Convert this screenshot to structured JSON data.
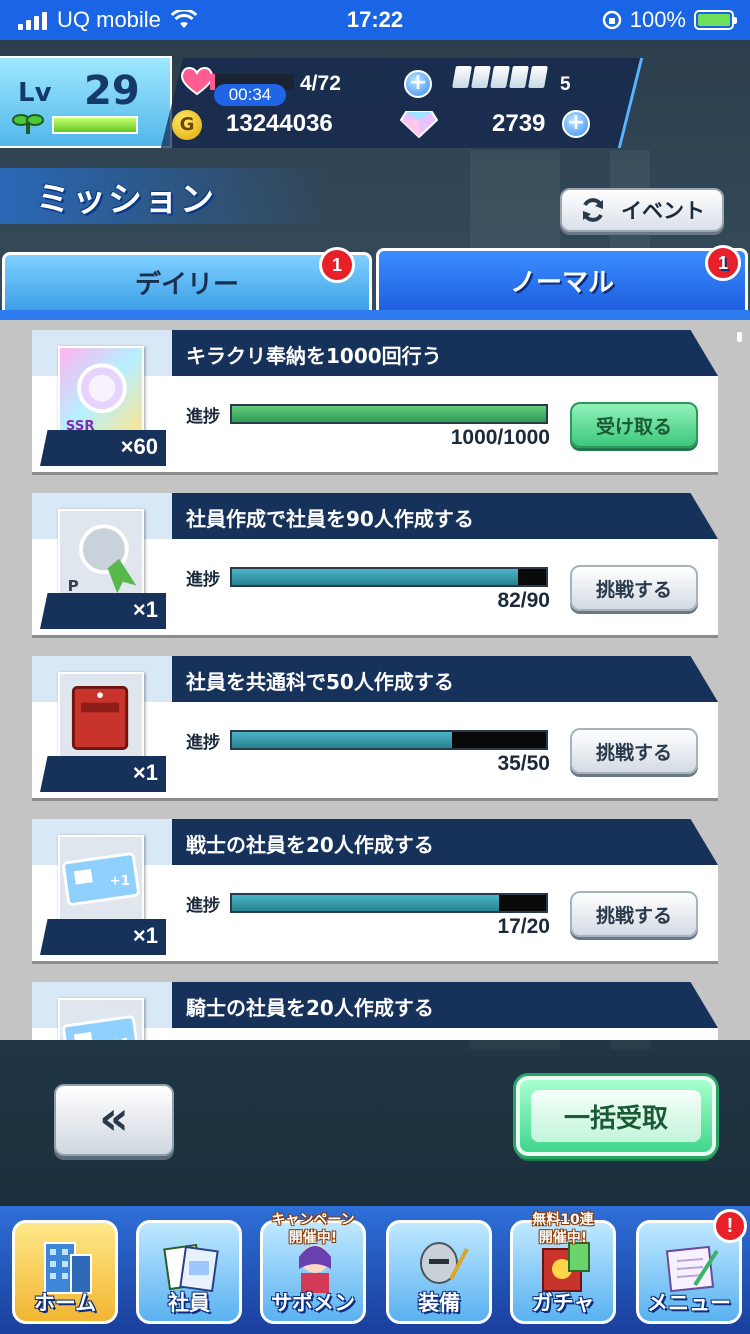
{
  "status_bar": {
    "carrier": "UQ mobile",
    "time": "17:22",
    "battery": "100%"
  },
  "player": {
    "level_label": "Lv",
    "level": "29",
    "exp_fraction": 1.0
  },
  "resources": {
    "stamina_timer": "00:34",
    "stamina": "4/72",
    "stamina_fraction": 0.06,
    "tickets": "5",
    "gold": "13244036",
    "gems": "2739"
  },
  "header": {
    "title": "ミッション",
    "event_button": "イベント"
  },
  "tabs": [
    {
      "label": "デイリー",
      "badge": "1"
    },
    {
      "label": "ノーマル",
      "badge": "1"
    }
  ],
  "progress_label": "進捗",
  "missions": [
    {
      "title": "キラクリ奉納を1000回行う",
      "reward_icon": "ssr-medal-icon",
      "qty": "×60",
      "progress": "1000/1000",
      "fraction": 1.0,
      "button": "受け取る",
      "state": "claim"
    },
    {
      "title": "社員作成で社員を90人作成する",
      "reward_icon": "silver-medal-icon",
      "qty": "×1",
      "progress": "82/90",
      "fraction": 0.911,
      "button": "挑戦する",
      "state": "challenge"
    },
    {
      "title": "社員を共通科で50人作成する",
      "reward_icon": "red-book-icon",
      "qty": "×1",
      "progress": "35/50",
      "fraction": 0.7,
      "button": "挑戦する",
      "state": "challenge"
    },
    {
      "title": "戦士の社員を20人作成する",
      "reward_icon": "ticket-icon",
      "qty": "×1",
      "progress": "17/20",
      "fraction": 0.85,
      "button": "挑戦する",
      "state": "challenge"
    },
    {
      "title": "騎士の社員を20人作成する",
      "reward_icon": "ticket-icon",
      "qty": "",
      "progress": "",
      "fraction": 0,
      "button": "",
      "state": "partial"
    }
  ],
  "actions": {
    "back": "«",
    "claim_all": "一括受取"
  },
  "nav": [
    {
      "label": "ホーム",
      "tag": "",
      "icon": "building-icon",
      "active": true,
      "badge": ""
    },
    {
      "label": "社員",
      "tag": "",
      "icon": "employee-cards-icon",
      "active": false,
      "badge": ""
    },
    {
      "label": "サポメン",
      "tag": "キャンペーン\n開催中!",
      "icon": "support-member-icon",
      "active": false,
      "badge": ""
    },
    {
      "label": "装備",
      "tag": "",
      "icon": "armor-icon",
      "active": false,
      "badge": ""
    },
    {
      "label": "ガチャ",
      "tag": "無料10連\n開催中!",
      "icon": "gacha-icon",
      "active": false,
      "badge": ""
    },
    {
      "label": "メニュー",
      "tag": "",
      "icon": "notebook-icon",
      "active": false,
      "badge": "!"
    }
  ]
}
